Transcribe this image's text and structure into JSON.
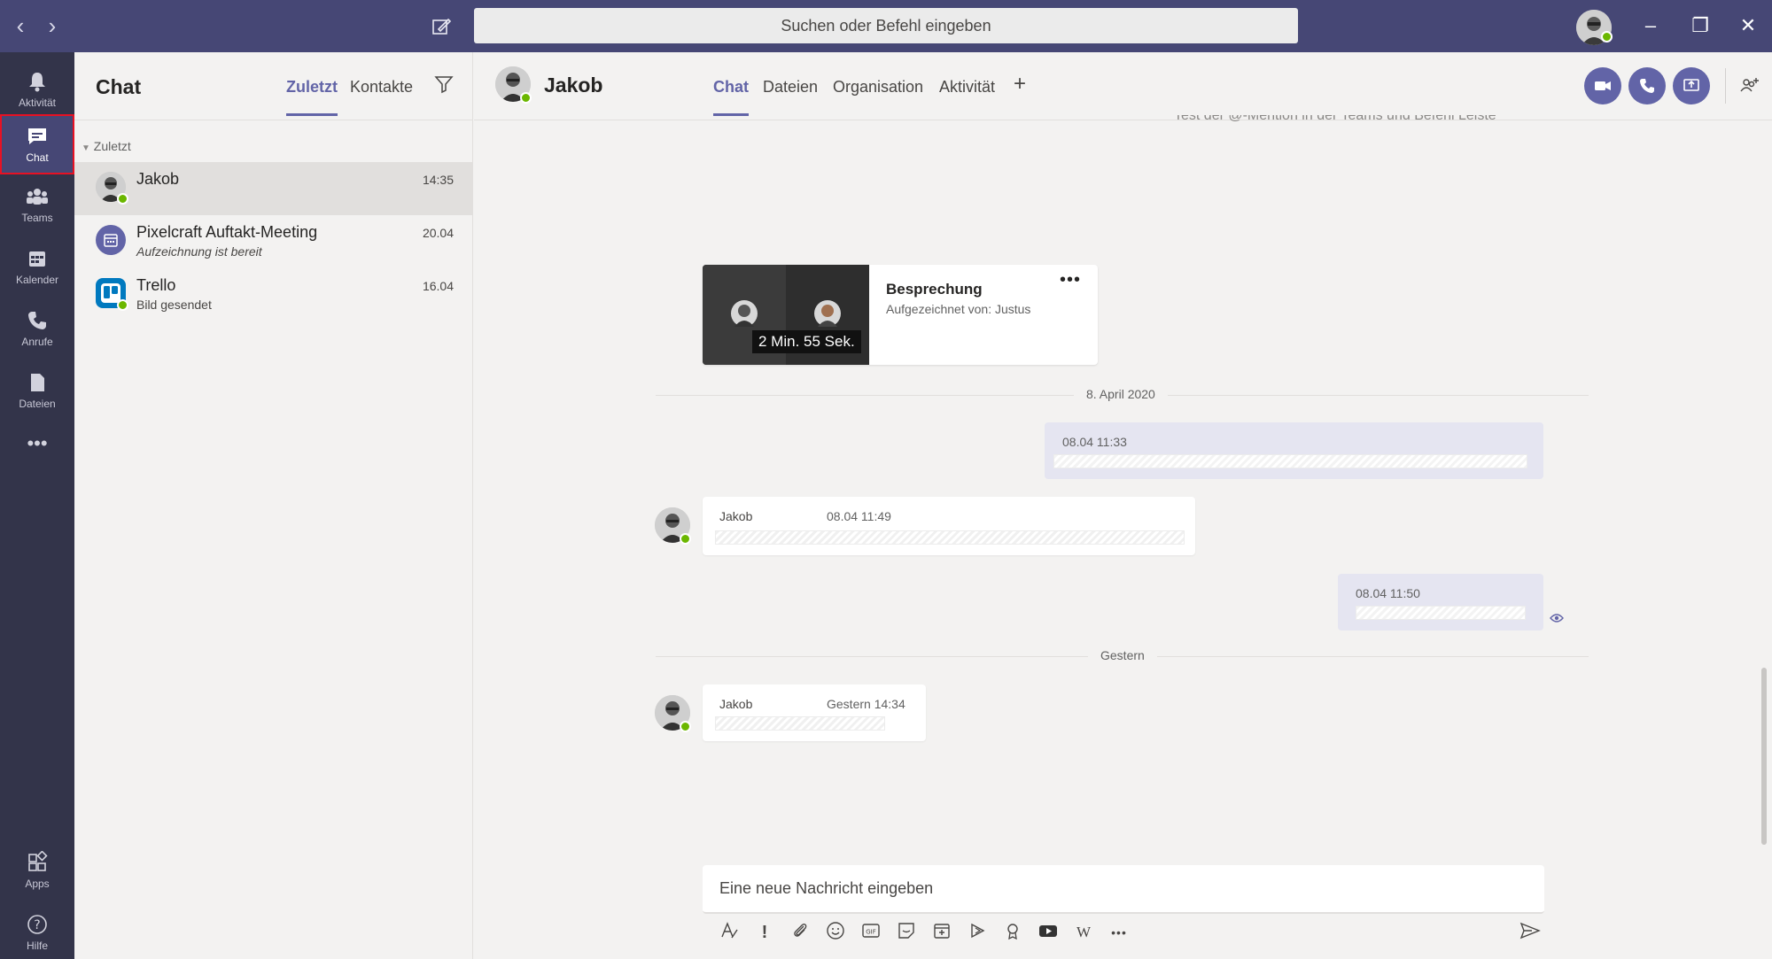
{
  "titlebar": {
    "search_placeholder": "Suchen oder Befehl eingeben",
    "back_icon": "chevron-left-icon",
    "forward_icon": "chevron-right-icon",
    "compose_icon": "compose-icon"
  },
  "rail": {
    "items": [
      {
        "label": "Aktivität",
        "icon": "bell-icon"
      },
      {
        "label": "Chat",
        "icon": "chat-icon",
        "active": true
      },
      {
        "label": "Teams",
        "icon": "teams-icon"
      },
      {
        "label": "Kalender",
        "icon": "calendar-icon"
      },
      {
        "label": "Anrufe",
        "icon": "phone-icon"
      },
      {
        "label": "Dateien",
        "icon": "file-icon"
      }
    ],
    "bottom": [
      {
        "label": "Apps",
        "icon": "apps-icon"
      },
      {
        "label": "Hilfe",
        "icon": "help-icon"
      }
    ]
  },
  "chatlist": {
    "title": "Chat",
    "tabs": [
      "Zuletzt",
      "Kontakte"
    ],
    "section": "Zuletzt",
    "conversations": [
      {
        "name": "Jakob",
        "subtitle": "",
        "time": "14:35"
      },
      {
        "name": "Pixelcraft Auftakt-Meeting",
        "subtitle": "Aufzeichnung ist bereit",
        "time": "20.04"
      },
      {
        "name": "Trello",
        "subtitle": "Bild gesendet",
        "time": "16.04"
      }
    ]
  },
  "main": {
    "contact_name": "Jakob",
    "tabs": [
      "Chat",
      "Dateien",
      "Organisation",
      "Aktivität"
    ],
    "add_tab": "+"
  },
  "messages": {
    "faded_top_text": "Test der @-Mention in der Teams und Befehl Leiste",
    "recording_card": {
      "title": "Besprechung",
      "subtitle": "Aufgezeichnet von: Justus",
      "duration": "2 Min. 55 Sek.",
      "more": "•••"
    },
    "date_dividers": [
      "8. April 2020",
      "Gestern"
    ],
    "items": [
      {
        "from": "me",
        "meta": "08.04 11:33"
      },
      {
        "from": "them",
        "author": "Jakob",
        "meta": "08.04 11:49"
      },
      {
        "from": "me",
        "meta": "08.04 11:50"
      },
      {
        "from": "them",
        "author": "Jakob",
        "meta": "Gestern 14:34"
      }
    ]
  },
  "compose": {
    "placeholder": "Eine neue Nachricht eingeben"
  },
  "colors": {
    "brand": "#6264a7",
    "titlebar": "#464775",
    "rail": "#33344a",
    "presence": "#6bb700"
  }
}
